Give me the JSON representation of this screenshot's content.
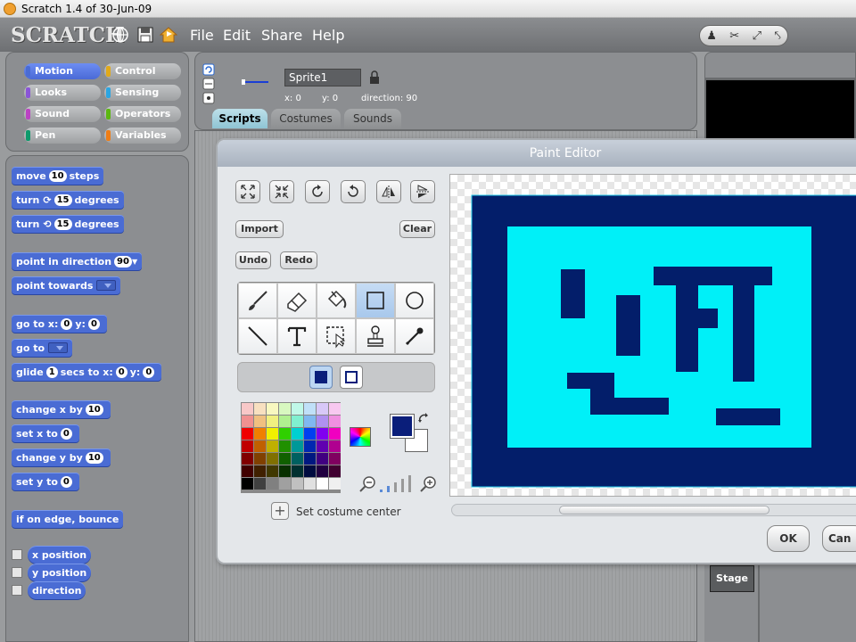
{
  "window": {
    "title": "Scratch 1.4 of 30-Jun-09"
  },
  "menubar": {
    "logo": "SCRATCH",
    "menus": [
      "File",
      "Edit",
      "Share",
      "Help"
    ]
  },
  "categories": [
    {
      "label": "Motion",
      "color": "#4a6cd4",
      "selected": true
    },
    {
      "label": "Control",
      "color": "#e1a91a"
    },
    {
      "label": "Looks",
      "color": "#8a55d7"
    },
    {
      "label": "Sensing",
      "color": "#2ca5e2"
    },
    {
      "label": "Sound",
      "color": "#bb42c3"
    },
    {
      "label": "Operators",
      "color": "#5cb712"
    },
    {
      "label": "Pen",
      "color": "#0e9a6c"
    },
    {
      "label": "Variables",
      "color": "#ee7d16"
    }
  ],
  "blocks": {
    "move": {
      "a": "move",
      "n": "10",
      "b": "steps"
    },
    "turn_cw": {
      "a": "turn",
      "n": "15",
      "b": "degrees"
    },
    "turn_ccw": {
      "a": "turn",
      "n": "15",
      "b": "degrees"
    },
    "point_dir": {
      "a": "point in direction",
      "n": "90"
    },
    "point_towards": {
      "a": "point towards"
    },
    "goto_xy": {
      "a": "go to x:",
      "x": "0",
      "y_label": "y:",
      "y": "0"
    },
    "goto": {
      "a": "go to"
    },
    "glide": {
      "a": "glide",
      "n": "1",
      "b": "secs to x:",
      "x": "0",
      "y_label": "y:",
      "y": "0"
    },
    "change_x": {
      "a": "change x by",
      "n": "10"
    },
    "set_x": {
      "a": "set x to",
      "n": "0"
    },
    "change_y": {
      "a": "change y by",
      "n": "10"
    },
    "set_y": {
      "a": "set y to",
      "n": "0"
    },
    "bounce": {
      "a": "if on edge, bounce"
    },
    "x_position": "x position",
    "y_position": "y position",
    "direction": "direction"
  },
  "sprite": {
    "name": "Sprite1",
    "x_label": "x:",
    "x": "0",
    "y_label": "y:",
    "y": "0",
    "dir_label": "direction:",
    "dir": "90"
  },
  "tabs": [
    "Scripts",
    "Costumes",
    "Sounds"
  ],
  "stage_list": {
    "stage_label": "Stage"
  },
  "paint_editor": {
    "title": "Paint Editor",
    "import": "Import",
    "clear": "Clear",
    "undo": "Undo",
    "redo": "Redo",
    "set_center": "Set costume center",
    "ok": "OK",
    "cancel": "Can",
    "foreground_color": "#0a1e7a",
    "background_color": "#ffffff",
    "palette": [
      "#f8c8c8",
      "#f8e0c0",
      "#f8f8c0",
      "#d8f8c0",
      "#c0f8e8",
      "#c0e0f8",
      "#d8c8f8",
      "#f8c8f0",
      "#f09090",
      "#f0c080",
      "#f0f080",
      "#b0f090",
      "#80f0d0",
      "#80b8f0",
      "#b090f0",
      "#f090e0",
      "#f00000",
      "#f08000",
      "#f0f000",
      "#30d000",
      "#00d0d0",
      "#0040f0",
      "#8000f0",
      "#f000c0",
      "#c00000",
      "#c06000",
      "#c0b000",
      "#209000",
      "#009898",
      "#0028b0",
      "#6000b0",
      "#b00090",
      "#800000",
      "#804000",
      "#807000",
      "#106000",
      "#006060",
      "#001880",
      "#400080",
      "#800060",
      "#400000",
      "#402000",
      "#403800",
      "#083000",
      "#003030",
      "#000c40",
      "#200040",
      "#400030",
      "#000000",
      "#404040",
      "#808080",
      "#a0a0a0",
      "#c0c0c0",
      "#e0e0e0",
      "#ffffff",
      "#f0f0f0"
    ]
  }
}
